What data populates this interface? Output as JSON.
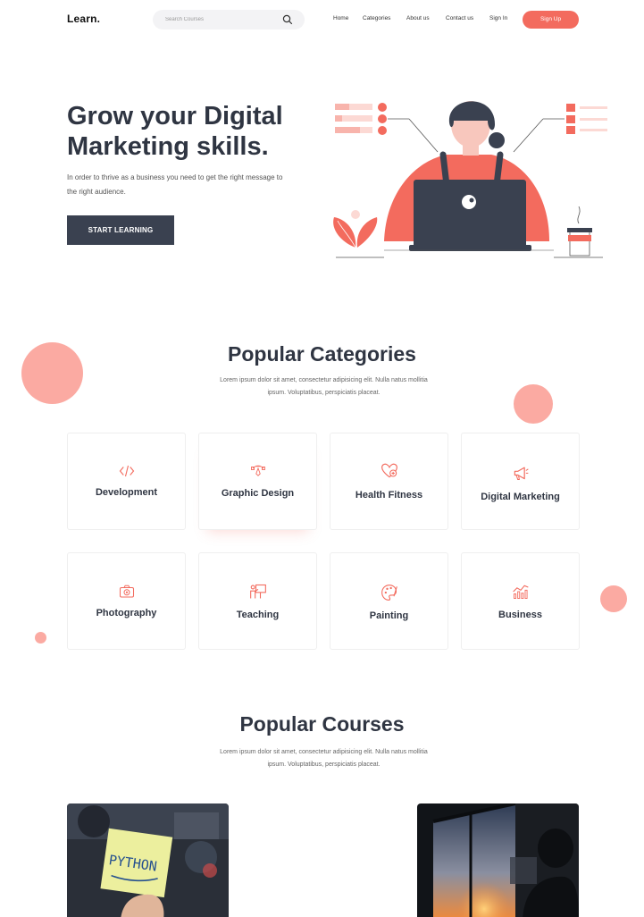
{
  "nav": {
    "logo": "Learn.",
    "search_placeholder": "Search Courses",
    "links": [
      "Home",
      "Categories",
      "About us",
      "Contact us",
      "Sign In"
    ],
    "signup": "Sign Up"
  },
  "hero": {
    "title_line1": "Grow your Digital",
    "title_line2": "Marketing skills.",
    "subtitle": "In order to thrive as a business you need to get the right message to the right audience.",
    "cta": "START LEARNING"
  },
  "categories": {
    "title": "Popular Categories",
    "subtitle": "Lorem ipsum dolor sit amet, consectetur adipisicing elit. Nulla natus mollitia ipsum. Voluptatibus, perspiciatis placeat.",
    "items": [
      {
        "label": "Development",
        "icon": "code-icon"
      },
      {
        "label": "Graphic Design",
        "icon": "bezier-pen-icon"
      },
      {
        "label": "Health Fitness",
        "icon": "heart-plus-icon"
      },
      {
        "label": "Digital Marketing",
        "icon": "megaphone-icon"
      },
      {
        "label": "Photography",
        "icon": "camera-icon"
      },
      {
        "label": "Teaching",
        "icon": "teacher-board-icon"
      },
      {
        "label": "Painting",
        "icon": "palette-icon"
      },
      {
        "label": "Business",
        "icon": "chart-bars-icon"
      }
    ]
  },
  "courses": {
    "title": "Popular Courses",
    "subtitle": "Lorem ipsum dolor sit amet, consectetur adipisicing elit. Nulla natus mollitia ipsum. Voluptatibus, perspiciatis placeat.",
    "sticky_note": "PYTHON"
  },
  "colors": {
    "accent": "#f36b5e",
    "dark": "#3a4150",
    "decor": "#fbaaa2"
  }
}
